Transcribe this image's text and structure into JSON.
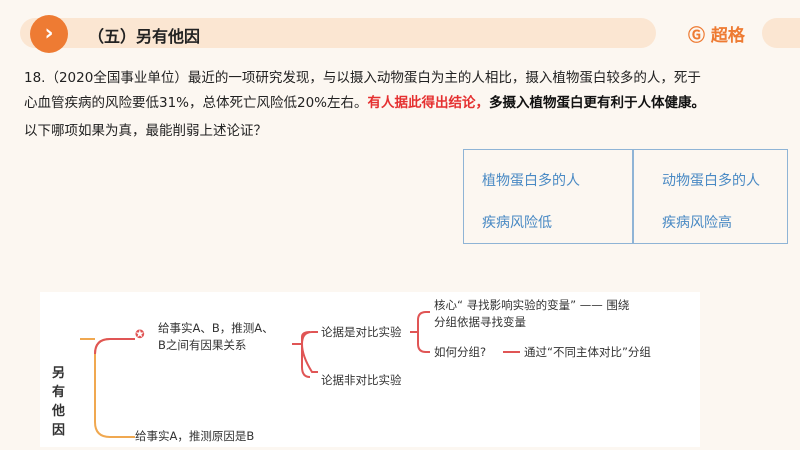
{
  "header": {
    "icon": "chevron-right-icon",
    "title": "（五）另有他因",
    "logo": "超格"
  },
  "question": {
    "line1": "18.（2020全国事业单位）最近的一项研究发现，与以摄入动物蛋白为主的人相比，摄入植物蛋白较多的人，死于",
    "line2_plain": "心血管疾病的风险要低31%，总体死亡风险低20%左右。",
    "line2_red": "有人据此得出结论，",
    "line2_bold": "多摄入植物蛋白更有利于人体健康。",
    "line3": "以下哪项如果为真，最能削弱上述论证？"
  },
  "table": {
    "left_top": "植物蛋白多的人",
    "left_bottom": "疾病风险低",
    "right_top": "动物蛋白多的人",
    "right_bottom": "疾病风险高"
  },
  "mindmap": {
    "root": "另有他因",
    "branch1": "给事实A、B，推测A、",
    "branch1b": "B之间有因果关系",
    "branch1_icon": "star-icon",
    "sub1": "论据是对比实验",
    "sub2": "论据非对比实验",
    "leaf1a": "核心“ 寻找影响实验的变量” —— 围绕",
    "leaf1b": "分组依据寻找变量",
    "leaf2": "如何分组?",
    "leaf2b": "通过“不同主体对比”分组",
    "branch2": "给事实A，推测原因是B"
  }
}
